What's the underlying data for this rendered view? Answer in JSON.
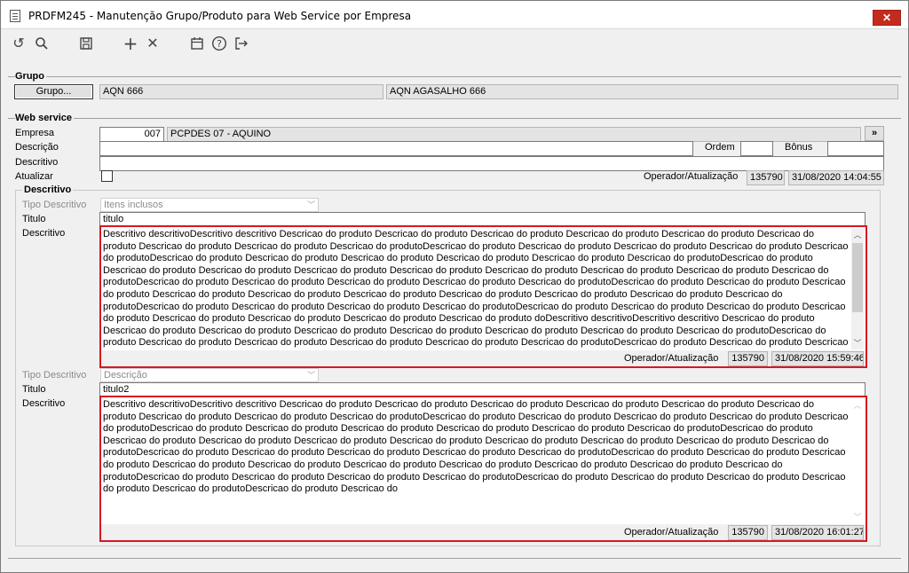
{
  "window": {
    "title": "PRDFM245 - Manutenção Grupo/Produto para Web Service por Empresa",
    "close_label": "✕"
  },
  "toolbar": {
    "undo_icon": "↺",
    "search_icon": "⚲",
    "save_icon": "💾",
    "add_icon": "+",
    "delete_icon": "✕",
    "calendar_icon": "📅",
    "help_icon": "?",
    "exit_icon": "⇥"
  },
  "grupo": {
    "section_label": "Grupo",
    "button_label": "Grupo...",
    "code": "AQN 666",
    "name": "AQN AGASALHO 666"
  },
  "webservice": {
    "section_label": "Web service",
    "empresa_label": "Empresa",
    "empresa_code": "007",
    "empresa_name": "PCPDES 07 - AQUINO",
    "more_button": "»",
    "descricao_label": "Descrição",
    "descricao_value": "",
    "ordem_label": "Ordem",
    "ordem_value": "",
    "bonus_label": "Bônus",
    "bonus_value": "",
    "descritivo_label": "Descritivo",
    "descritivo_value": "",
    "atualizar_label": "Atualizar",
    "operador_label": "Operador/Atualização",
    "operador_code": "135790",
    "operador_date": "31/08/2020 14:04:55"
  },
  "descritivo": {
    "section_label": "Descritivo",
    "items": [
      {
        "tipo_label": "Tipo Descritivo",
        "tipo_value": "Itens inclusos",
        "titulo_label": "Titulo",
        "titulo_value": "titulo",
        "descritivo_label": "Descritivo",
        "text": "Descritivo descritivoDescritivo descritivo Descricao do produto Descricao do produto Descricao do produto Descricao do produto Descricao do produto Descricao do produto Descricao do produto Descricao do produto Descricao do produtoDescricao do produto Descricao do produto Descricao do produto Descricao do produto Descricao do produtoDescricao do produto Descricao do produto Descricao do produto Descricao do produto Descricao do produto Descricao do produtoDescricao do produto Descricao do produto Descricao do produto Descricao do produto Descricao do produto Descricao do produto Descricao do produto Descricao do produto Descricao do produtoDescricao do produto Descricao do produto Descricao do produto Descricao do produto Descricao do produtoDescricao do produto Descricao do produto Descricao do produto Descricao do produto Descricao do produto Descricao do produto Descricao do produto Descricao do produto Descricao do produto Descricao do produtoDescricao do produto Descricao do produto Descricao do produto Descricao do produtoDescricao do produto Descricao do produto Descricao do produto Descricao do produto Descricao do produto Descricao do produto Descricao do produto Descricao do produto doDescritivo descritivoDescritivo descritivo Descricao do produto Descricao do produto Descricao do produto Descricao do produto Descricao do produto Descricao do produto Descricao do produto Descricao do produtoDescricao do produto Descricao do produto Descricao do produto Descricao do produto Descricao do produto Descricao do produtoDescricao do produto Descricao do produto Descricao do produto Descricao do produto Descricao do produto Descricao do produto Descricao do produto Descricao do produto Descricao do produto Descricao do produtoDescricao do produto Descricao do produto Descricao do produto Descricao do produtoDescricao do produto Descricao do produto Descricao do produto Descricao do produto Descricao do produto Descricao do produto Descricao do produto Descricao",
        "operador_label": "Operador/Atualização",
        "operador_code": "135790",
        "operador_date": "31/08/2020 15:59:46"
      },
      {
        "tipo_label": "Tipo Descritivo",
        "tipo_value": "Descrição",
        "titulo_label": "Titulo",
        "titulo_value": "titulo2",
        "descritivo_label": "Descritivo",
        "text": "Descritivo descritivoDescritivo descritivo Descricao do produto Descricao do produto Descricao do produto Descricao do produto Descricao do produto Descricao do produto Descricao do produto Descricao do produto Descricao do produtoDescricao do produto Descricao do produto Descricao do produto Descricao do produto Descricao do produtoDescricao do produto Descricao do produto Descricao do produto Descricao do produto Descricao do produto Descricao do produtoDescricao do produto Descricao do produto Descricao do produto Descricao do produto Descricao do produto Descricao do produto Descricao do produto Descricao do produto Descricao do produtoDescricao do produto Descricao do produto Descricao do produto Descricao do produto Descricao do produtoDescricao do produto Descricao do produto Descricao do produto Descricao do produto Descricao do produto Descricao do produto Descricao do produto Descricao do produto Descricao do produto Descricao do produtoDescricao do produto Descricao do produto Descricao do produto Descricao do produtoDescricao do produto Descricao do produto Descricao do produto Descricao do produto Descricao do produtoDescricao do produto Descricao do",
        "operador_label": "Operador/Atualização",
        "operador_code": "135790",
        "operador_date": "31/08/2020 16:01:27"
      }
    ]
  }
}
